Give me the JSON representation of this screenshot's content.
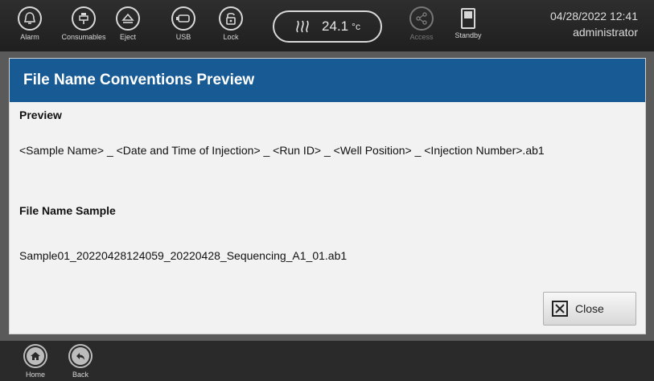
{
  "toolbar": {
    "alarm_label": "Alarm",
    "consumables_label": "Consumables",
    "eject_label": "Eject",
    "usb_label": "USB",
    "lock_label": "Lock",
    "temperature_value": "24.1",
    "temperature_unit": "°c",
    "access_label": "Access",
    "standby_label": "Standby",
    "datetime": "04/28/2022 12:41",
    "user": "administrator"
  },
  "dialog": {
    "title": "File Name Conventions Preview",
    "preview_heading": "Preview",
    "preview_text": "<Sample Name> _ <Date and Time of Injection> _ <Run ID> _ <Well Position> _ <Injection Number>.ab1",
    "sample_heading": "File Name Sample",
    "sample_text": "Sample01_20220428124059_20220428_Sequencing_A1_01.ab1",
    "close_label": "Close"
  },
  "bottombar": {
    "home_label": "Home",
    "back_label": "Back"
  },
  "colors": {
    "header_blue": "#175a94",
    "toolbar_bg": "#262626"
  }
}
